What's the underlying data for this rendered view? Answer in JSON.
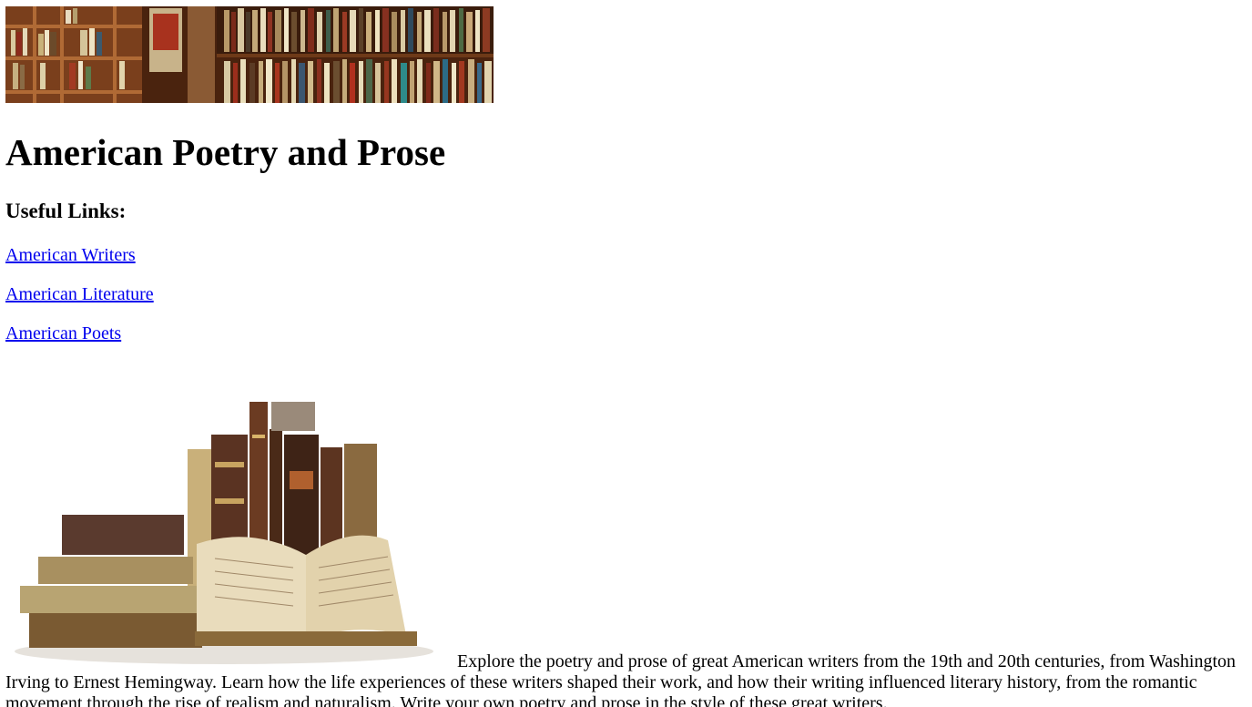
{
  "page": {
    "title": "American Poetry and Prose",
    "banner_image": "bookshelf-banner-image",
    "books_image": "antique-books-image"
  },
  "links_section": {
    "heading": "Useful Links:",
    "links": [
      {
        "label": "American Writers"
      },
      {
        "label": "American Literature"
      },
      {
        "label": "American Poets"
      }
    ],
    "link_color": "#0000ee"
  },
  "intro": {
    "text": "Explore the poetry and prose of great American writers from the 19th and 20th centuries, from Washington Irving to Ernest Hemingway. Learn how the life experiences of these writers shaped their work, and how their writing influenced literary history, from the romantic movement through the rise of realism and naturalism. Write your own poetry and prose in the style of these great writers."
  }
}
